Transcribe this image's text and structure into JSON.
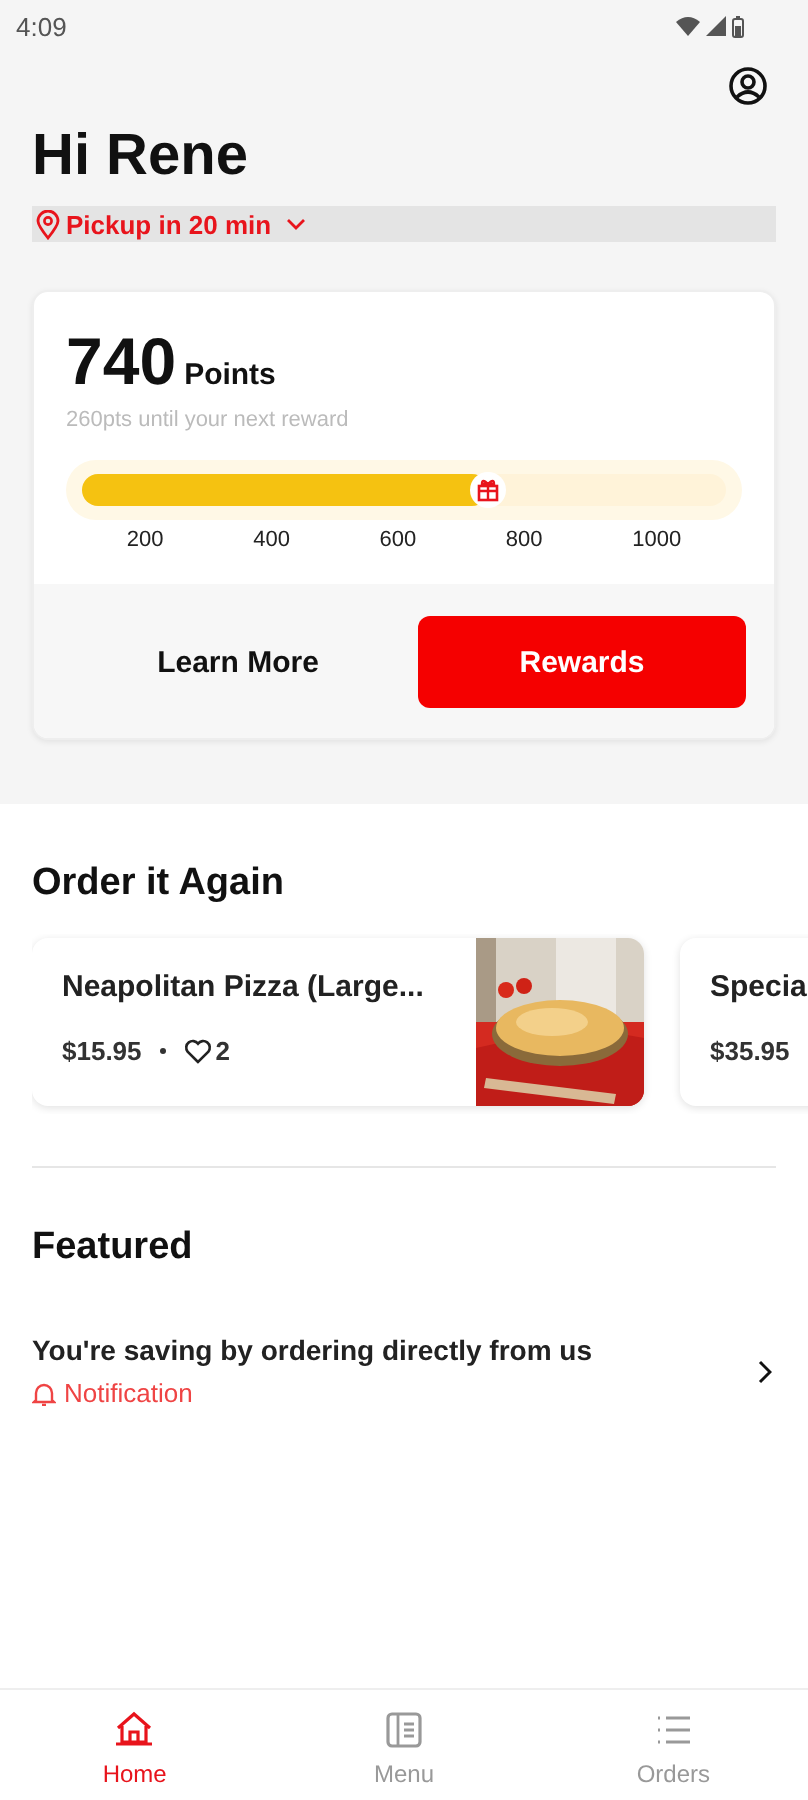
{
  "status_bar": {
    "time": "4:09"
  },
  "greeting": "Hi Rene",
  "pickup": {
    "label": "Pickup in 20 min"
  },
  "rewards": {
    "points": "740",
    "points_label": "Points",
    "subtitle": "260pts until your next reward",
    "level": 0.63,
    "ticks": [
      "200",
      "400",
      "600",
      "800",
      "1000"
    ],
    "buttons": [
      {
        "label": "Learn More",
        "kind": "plain"
      },
      {
        "label": "Rewards",
        "kind": "primary"
      }
    ]
  },
  "order_again": {
    "title": "Order it Again",
    "items": [
      {
        "name": "Neapolitan Pizza (Large...",
        "price": "$15.95",
        "likes": "2",
        "kind": "picture"
      },
      {
        "name": "Specia",
        "price": "$35.95"
      }
    ]
  },
  "featured": {
    "title": "Featured",
    "items": [
      {
        "title": "You're saving by ordering directly from us",
        "tag": "Notification"
      }
    ]
  },
  "nav": [
    {
      "label": "Home",
      "kind": "home",
      "selected": true
    },
    {
      "label": "Menu",
      "kind": "menu",
      "selected": false
    },
    {
      "label": "Orders",
      "kind": "orders",
      "selected": false
    }
  ]
}
